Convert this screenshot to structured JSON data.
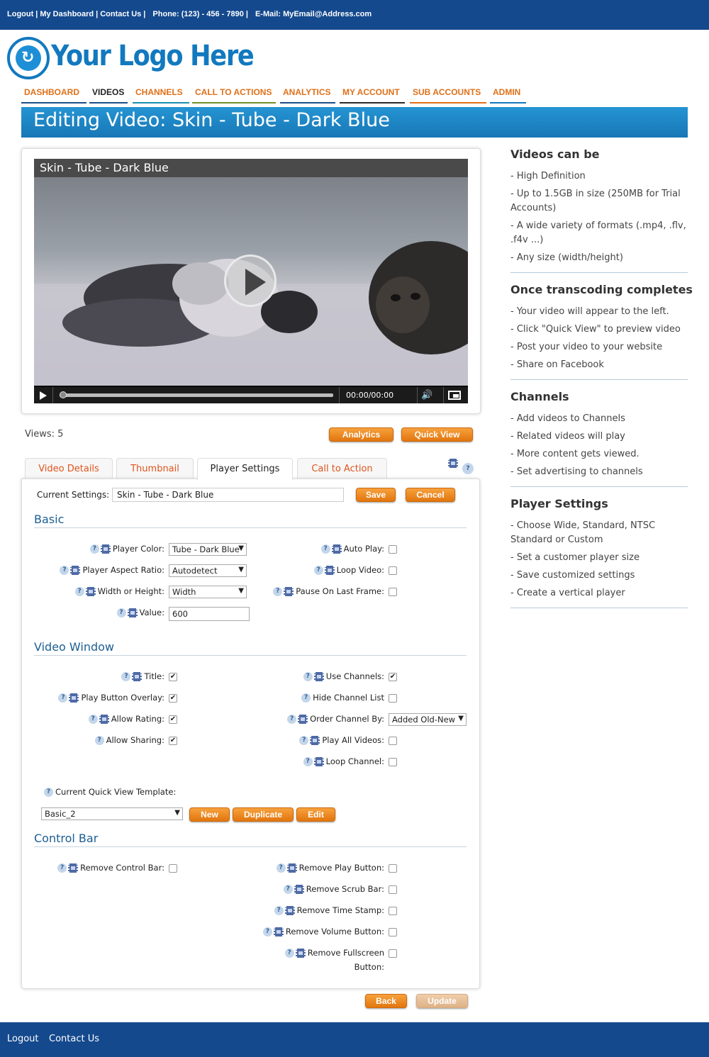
{
  "topbar": {
    "logout": "Logout",
    "dashboard": "My Dashboard",
    "contact": "Contact Us",
    "phone": "Phone: (123) - 456 - 7890",
    "email": "E-Mail: MyEmail@Address.com"
  },
  "logo": {
    "text": "Your Logo Here"
  },
  "nav": [
    {
      "label": "DASHBOARD"
    },
    {
      "label": "VIDEOS"
    },
    {
      "label": "CHANNELS"
    },
    {
      "label": "CALL TO ACTIONS"
    },
    {
      "label": "ANALYTICS"
    },
    {
      "label": "MY ACCOUNT"
    },
    {
      "label": "SUB ACCOUNTS"
    },
    {
      "label": "ADMIN"
    }
  ],
  "page_title": "Editing Video: Skin - Tube - Dark Blue",
  "player": {
    "video_title": "Skin -  Tube - Dark Blue",
    "timestamp": "00:00/00:00"
  },
  "views": "Views: 5",
  "buttons": {
    "analytics": "Analytics",
    "quick_view": "Quick View",
    "save": "Save",
    "cancel": "Cancel",
    "new": "New",
    "duplicate": "Duplicate",
    "edit": "Edit",
    "back": "Back",
    "update": "Update"
  },
  "tabs": [
    {
      "label": "Video Details"
    },
    {
      "label": "Thumbnail"
    },
    {
      "label": "Player Settings"
    },
    {
      "label": "Call to Action"
    }
  ],
  "current_settings": {
    "label": "Current Settings:",
    "value": "Skin - Tube - Dark Blue"
  },
  "help_glyph": "?",
  "sections": {
    "basic": "Basic",
    "video_window": "Video Window",
    "control_bar": "Control Bar"
  },
  "basic": {
    "player_color": {
      "label": "Player Color:",
      "value": "Tube - Dark Blue"
    },
    "aspect_ratio": {
      "label": "Player Aspect Ratio:",
      "value": "Autodetect"
    },
    "width_height": {
      "label": "Width or Height:",
      "value": "Width"
    },
    "value": {
      "label": "Value:",
      "value": "600"
    },
    "auto_play": {
      "label": "Auto Play:"
    },
    "loop_video": {
      "label": "Loop Video:"
    },
    "pause_last": {
      "label": "Pause On Last Frame:"
    }
  },
  "video_window": {
    "title": {
      "label": "Title:"
    },
    "play_overlay": {
      "label": "Play Button Overlay:"
    },
    "allow_rating": {
      "label": "Allow Rating:"
    },
    "allow_sharing": {
      "label": "Allow Sharing:"
    },
    "use_channels": {
      "label": "Use Channels:"
    },
    "hide_channel_list": {
      "label": "Hide Channel List"
    },
    "order_channel": {
      "label": "Order Channel By:",
      "value": "Added Old-New"
    },
    "play_all": {
      "label": "Play All Videos:"
    },
    "loop_channel": {
      "label": "Loop Channel:"
    },
    "qv_template": {
      "label": "Current Quick View Template:",
      "value": "Basic_2"
    }
  },
  "control_bar": {
    "remove_control_bar": {
      "label": "Remove Control Bar:"
    },
    "remove_play": {
      "label": "Remove Play Button:"
    },
    "remove_scrub": {
      "label": "Remove Scrub Bar:"
    },
    "remove_time": {
      "label": "Remove Time Stamp:"
    },
    "remove_volume": {
      "label": "Remove Volume Button:"
    },
    "remove_fullscreen_1": {
      "label": "Remove Fullscreen"
    },
    "remove_fullscreen_2": {
      "label": "Button:"
    }
  },
  "sidebar": [
    {
      "title": "Videos can be",
      "items": [
        "- High Definition",
        "- Up to 1.5GB in size (250MB for Trial Accounts)",
        "- A wide variety of formats (.mp4, .flv, .f4v ...)",
        "- Any size (width/height)"
      ]
    },
    {
      "title": "Once transcoding completes",
      "items": [
        "- Your video will appear to the left.",
        "- Click \"Quick View\" to preview video",
        "- Post your video to your website",
        "- Share on Facebook"
      ]
    },
    {
      "title": "Channels",
      "items": [
        "- Add videos to Channels",
        "- Related videos will play",
        "- More content gets viewed.",
        "- Set advertising to channels"
      ]
    },
    {
      "title": "Player Settings",
      "items": [
        "- Choose Wide, Standard, NTSC Standard or Custom",
        "- Set a customer player size",
        "- Save customized settings",
        "- Create a vertical player"
      ]
    }
  ],
  "footer": {
    "logout": "Logout",
    "contact": "Contact Us"
  },
  "colors": {
    "brand_blue": "#14498d",
    "accent_orange": "#e2760e",
    "title_blue": "#1877b6"
  }
}
